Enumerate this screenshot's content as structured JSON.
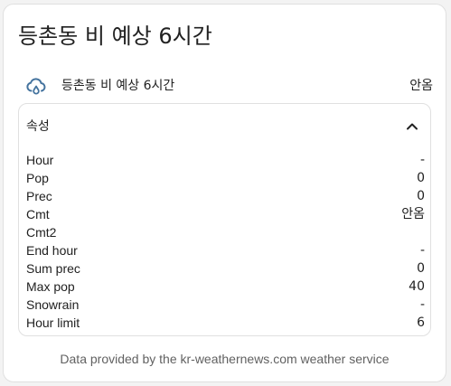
{
  "dialog": {
    "title": "등촌동 비 예상 6시간"
  },
  "entity": {
    "icon": "weather-rainy-cloud-icon",
    "name": "등촌동 비 예상 6시간",
    "state": "안옴"
  },
  "attributes": {
    "header_label": "속성",
    "expanded": true,
    "rows": [
      {
        "key": "Hour",
        "value": "-"
      },
      {
        "key": "Pop",
        "value": "0"
      },
      {
        "key": "Prec",
        "value": "0"
      },
      {
        "key": "Cmt",
        "value": "안옴"
      },
      {
        "key": "Cmt2",
        "value": ""
      },
      {
        "key": "End hour",
        "value": "-"
      },
      {
        "key": "Sum prec",
        "value": "0"
      },
      {
        "key": "Max pop",
        "value": "40"
      },
      {
        "key": "Snowrain",
        "value": "-"
      },
      {
        "key": "Hour limit",
        "value": "6"
      }
    ]
  },
  "attribution": "Data provided by the kr-weathernews.com weather service",
  "colors": {
    "icon": "#44739e",
    "border": "#e0e0e0",
    "text": "#212121",
    "secondary_text": "#616161"
  }
}
